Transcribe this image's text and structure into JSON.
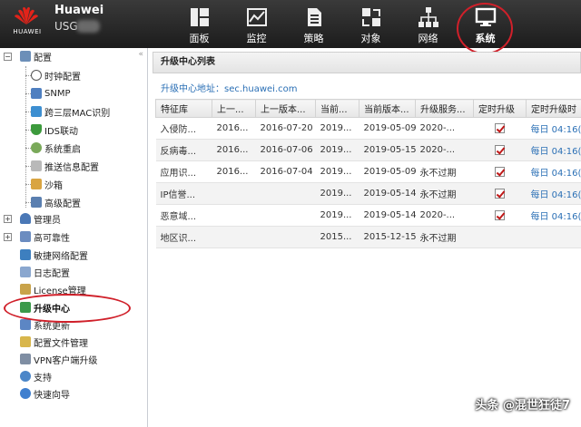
{
  "brand": {
    "logo_text": "HUAWEI",
    "name": "Huawei",
    "model": "USG"
  },
  "nav": [
    {
      "label": "面板",
      "icon": "dashboard-icon"
    },
    {
      "label": "监控",
      "icon": "monitor-chart-icon"
    },
    {
      "label": "策略",
      "icon": "policy-document-icon"
    },
    {
      "label": "对象",
      "icon": "object-icon"
    },
    {
      "label": "网络",
      "icon": "network-icon"
    },
    {
      "label": "系统",
      "icon": "system-monitor-icon",
      "active": true
    }
  ],
  "sidebar": {
    "items": [
      {
        "label": "配置"
      },
      {
        "label": "时钟配置"
      },
      {
        "label": "SNMP"
      },
      {
        "label": "跨三层MAC识别"
      },
      {
        "label": "IDS联动"
      },
      {
        "label": "系统重启"
      },
      {
        "label": "推送信息配置"
      },
      {
        "label": "沙箱"
      },
      {
        "label": "高级配置"
      },
      {
        "label": "管理员"
      },
      {
        "label": "高可靠性"
      },
      {
        "label": "敏捷网络配置"
      },
      {
        "label": "日志配置"
      },
      {
        "label": "License管理"
      },
      {
        "label": "升级中心",
        "active": true
      },
      {
        "label": "系统更新"
      },
      {
        "label": "配置文件管理"
      },
      {
        "label": "VPN客户端升级"
      },
      {
        "label": "支持"
      },
      {
        "label": "快速向导"
      }
    ]
  },
  "main": {
    "title": "升级中心列表",
    "address": "升级中心地址：sec.huawei.com",
    "columns": [
      "特征库",
      "上一...",
      "上一版本...",
      "当前...",
      "当前版本...",
      "升级服务...",
      "定时升级",
      "定时升级时"
    ],
    "rows": [
      {
        "c0": "入侵防...",
        "c1": "2016...",
        "c2": "2016-07-20",
        "c3": "2019...",
        "c4": "2019-05-09",
        "c5": "2020-...",
        "checked": true,
        "c7": "每日 04:16(..."
      },
      {
        "c0": "反病毒...",
        "c1": "2016...",
        "c2": "2016-07-06",
        "c3": "2019...",
        "c4": "2019-05-15",
        "c5": "2020-...",
        "checked": true,
        "c7": "每日 04:16(..."
      },
      {
        "c0": "应用识...",
        "c1": "2016...",
        "c2": "2016-07-04",
        "c3": "2019...",
        "c4": "2019-05-09",
        "c5": "永不过期",
        "checked": true,
        "c7": "每日 04:16(..."
      },
      {
        "c0": "IP信誉...",
        "c1": "",
        "c2": "",
        "c3": "2019...",
        "c4": "2019-05-14",
        "c5": "永不过期",
        "checked": true,
        "c7": "每日 04:16(..."
      },
      {
        "c0": "恶意域...",
        "c1": "",
        "c2": "",
        "c3": "2019...",
        "c4": "2019-05-14",
        "c5": "2020-...",
        "checked": true,
        "c7": "每日 04:16(..."
      },
      {
        "c0": "地区识...",
        "c1": "",
        "c2": "",
        "c3": "2015...",
        "c4": "2015-12-15",
        "c5": "永不过期",
        "checked": false,
        "c7": ""
      }
    ]
  },
  "watermark": "头条 @混世狂徒7",
  "colors": {
    "topbar": "#2b2b2b",
    "highlight": "#d0202a",
    "link": "#2a6fb5",
    "check": "#c01818"
  }
}
